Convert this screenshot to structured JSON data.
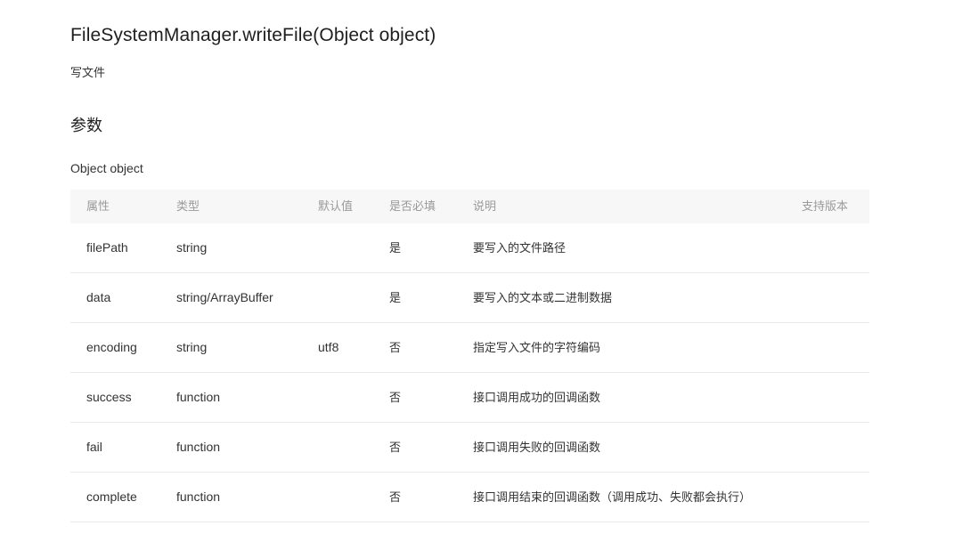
{
  "api": {
    "title": "FileSystemManager.writeFile(Object object)",
    "description": "写文件"
  },
  "params": {
    "section_title": "参数",
    "object_label": "Object object",
    "headers": {
      "name": "属性",
      "type": "类型",
      "default": "默认值",
      "required": "是否必填",
      "description": "说明",
      "version": "支持版本"
    },
    "rows": [
      {
        "name": "filePath",
        "type": "string",
        "default": "",
        "required": "是",
        "description": "要写入的文件路径",
        "version": ""
      },
      {
        "name": "data",
        "type": "string/ArrayBuffer",
        "default": "",
        "required": "是",
        "description": "要写入的文本或二进制数据",
        "version": ""
      },
      {
        "name": "encoding",
        "type": "string",
        "default": "utf8",
        "required": "否",
        "description": "指定写入文件的字符编码",
        "version": ""
      },
      {
        "name": "success",
        "type": "function",
        "default": "",
        "required": "否",
        "description": "接口调用成功的回调函数",
        "version": ""
      },
      {
        "name": "fail",
        "type": "function",
        "default": "",
        "required": "否",
        "description": "接口调用失败的回调函数",
        "version": ""
      },
      {
        "name": "complete",
        "type": "function",
        "default": "",
        "required": "否",
        "description": "接口调用结束的回调函数（调用成功、失败都会执行）",
        "version": ""
      }
    ]
  }
}
